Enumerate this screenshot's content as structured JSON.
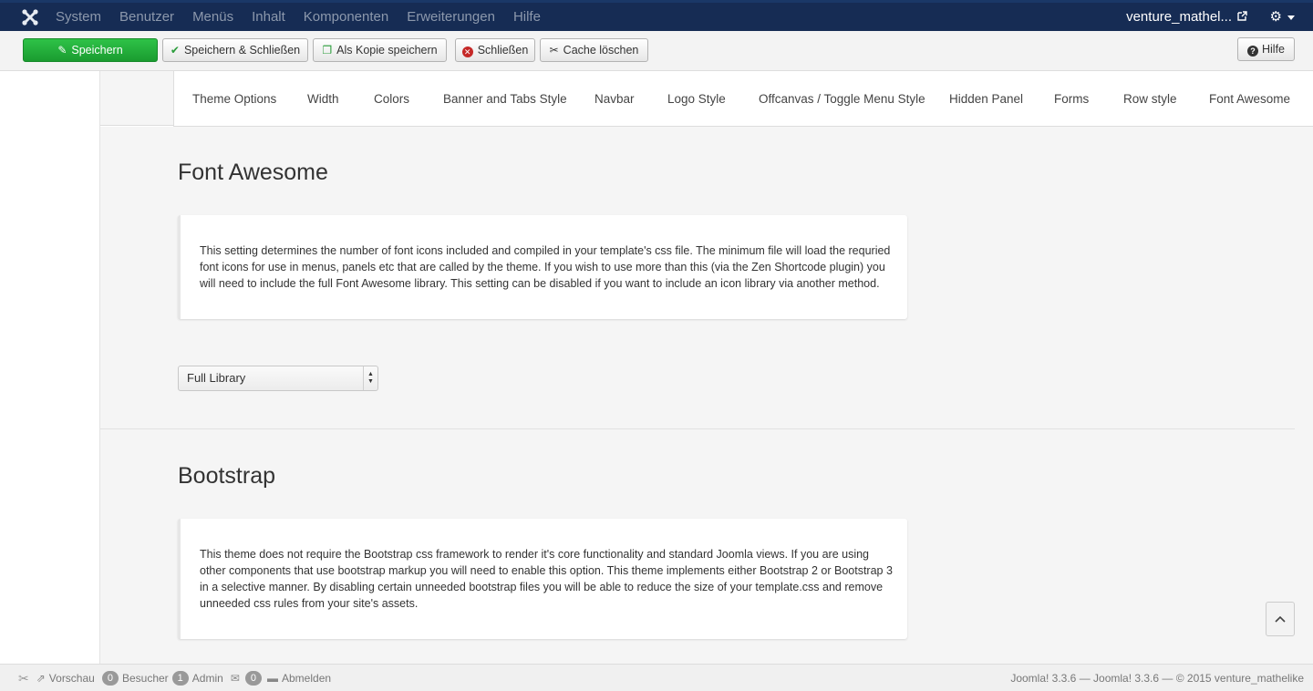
{
  "topnav": {
    "menu": [
      "System",
      "Benutzer",
      "Menüs",
      "Inhalt",
      "Komponenten",
      "Erweiterungen",
      "Hilfe"
    ],
    "user": "venture_mathel...",
    "logo_icon": "joomla-logo-icon",
    "external_icon": "external-link-icon",
    "settings_icon": "gear-icon"
  },
  "toolbar": {
    "save": "Speichern",
    "save_close": "Speichern & Schließen",
    "save_copy": "Als Kopie speichern",
    "close": "Schließen",
    "clear_cache": "Cache löschen",
    "help": "Hilfe"
  },
  "tabs": [
    "Theme Options",
    "Width",
    "Colors",
    "Banner and Tabs Style",
    "Navbar",
    "Logo Style",
    "Offcanvas / Toggle Menu Style",
    "Hidden Panel",
    "Forms",
    "Row style",
    "Font Awesome"
  ],
  "sections": {
    "font_awesome": {
      "title": "Font Awesome",
      "description": "This setting determines the number of font icons included and compiled in your template's css file. The minimum file will load the requried font icons for use in menus, panels etc that are called by the theme. If you wish to use more than this (via the Zen Shortcode plugin) you will need to include the full Font Awesome library. This setting can be disabled if you want to include an icon library via another method.",
      "select_value": "Full Library"
    },
    "bootstrap": {
      "title": "Bootstrap",
      "description": "This theme does not require the Bootstrap css framework to render it's core functionality and standard Joomla views. If you are using other components that use bootstrap markup you will need to enable this option. This theme implements either Bootstrap 2 or Bootstrap 3 in a selective manner. By disabling certain unneeded bootstrap files you will be able to reduce the size of your template.css and remove unneeded css rules from your site's assets."
    }
  },
  "statusbar": {
    "preview": "Vorschau",
    "visitors_count": "0",
    "visitors": "Besucher",
    "admin_count": "1",
    "admin": "Admin",
    "messages_count": "0",
    "logout": "Abmelden",
    "version_text": "Joomla! 3.3.6  —  Joomla! 3.3.6  —  © 2015 venture_mathelike"
  },
  "colors": {
    "navbar": "#162c54",
    "save_button": "#1fa636"
  }
}
